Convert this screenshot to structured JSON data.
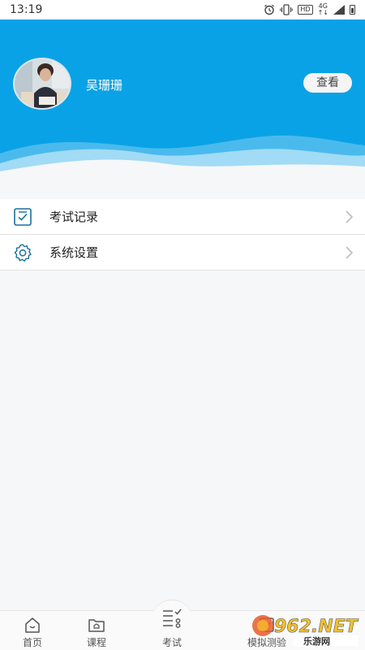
{
  "status_bar": {
    "time": "13:19",
    "icons": [
      "alarm-icon",
      "vibrate-icon",
      "hd-icon",
      "4g-icon",
      "signal-icon",
      "battery-icon"
    ],
    "hd": "HD",
    "network": "4G"
  },
  "profile": {
    "name": "吴珊珊",
    "view_button": "查看",
    "header_color": "#0aa2e6"
  },
  "menu": {
    "items": [
      {
        "label": "考试记录",
        "icon": "checkbox-icon"
      },
      {
        "label": "系统设置",
        "icon": "gear-icon"
      }
    ]
  },
  "tabbar": {
    "tabs": [
      {
        "label": "首页",
        "icon": "home-icon"
      },
      {
        "label": "课程",
        "icon": "folder-icon"
      },
      {
        "label": "考试",
        "icon": "exam-list-icon"
      },
      {
        "label": "模拟测验",
        "icon": "mock-test-icon"
      }
    ]
  },
  "watermark": {
    "text": "962.NET",
    "subtext": "乐游网"
  }
}
